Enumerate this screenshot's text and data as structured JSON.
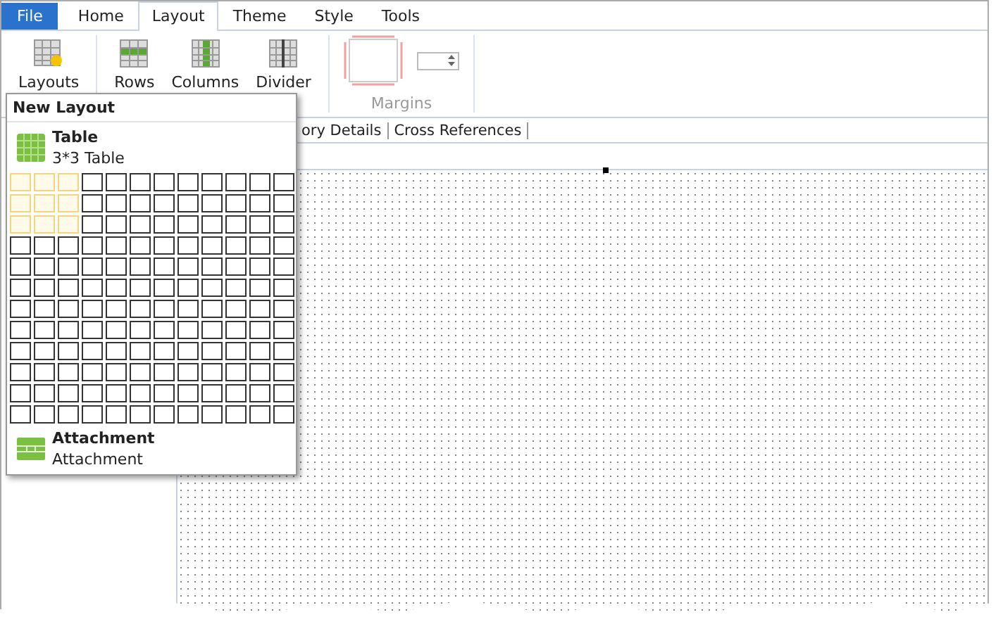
{
  "menu_tabs": [
    {
      "label": "File",
      "kind": "file",
      "selected": false
    },
    {
      "label": "Home",
      "kind": "tab",
      "selected": false
    },
    {
      "label": "Layout",
      "kind": "tab",
      "selected": true
    },
    {
      "label": "Theme",
      "kind": "tab",
      "selected": false
    },
    {
      "label": "Style",
      "kind": "tab",
      "selected": false
    },
    {
      "label": "Tools",
      "kind": "tab",
      "selected": false
    }
  ],
  "ribbon": {
    "layouts_button": "Layouts",
    "table_buttons": [
      {
        "label": "Rows",
        "kind": "rows"
      },
      {
        "label": "Columns",
        "kind": "columns"
      },
      {
        "label": "Divider",
        "kind": "divider"
      }
    ],
    "margins_group": "Margins"
  },
  "document_tabs": [
    "ory Details",
    "Cross References"
  ],
  "new_layout_menu": {
    "title": "New Layout",
    "table_item": {
      "title": "Table",
      "subtitle": "3*3 Table"
    },
    "grid_rows": [
      {
        "selected": [
          true,
          true,
          true,
          false,
          false,
          false,
          false,
          false,
          false,
          false,
          false,
          false
        ]
      },
      {
        "selected": [
          true,
          true,
          true,
          false,
          false,
          false,
          false,
          false,
          false,
          false,
          false,
          false
        ]
      },
      {
        "selected": [
          true,
          true,
          true,
          false,
          false,
          false,
          false,
          false,
          false,
          false,
          false,
          false
        ]
      },
      {
        "selected": [
          false,
          false,
          false,
          false,
          false,
          false,
          false,
          false,
          false,
          false,
          false,
          false
        ]
      },
      {
        "selected": [
          false,
          false,
          false,
          false,
          false,
          false,
          false,
          false,
          false,
          false,
          false,
          false
        ]
      },
      {
        "selected": [
          false,
          false,
          false,
          false,
          false,
          false,
          false,
          false,
          false,
          false,
          false,
          false
        ]
      },
      {
        "selected": [
          false,
          false,
          false,
          false,
          false,
          false,
          false,
          false,
          false,
          false,
          false,
          false
        ]
      },
      {
        "selected": [
          false,
          false,
          false,
          false,
          false,
          false,
          false,
          false,
          false,
          false,
          false,
          false
        ]
      },
      {
        "selected": [
          false,
          false,
          false,
          false,
          false,
          false,
          false,
          false,
          false,
          false,
          false,
          false
        ]
      },
      {
        "selected": [
          false,
          false,
          false,
          false,
          false,
          false,
          false,
          false,
          false,
          false,
          false,
          false
        ]
      },
      {
        "selected": [
          false,
          false,
          false,
          false,
          false,
          false,
          false,
          false,
          false,
          false,
          false,
          false
        ]
      },
      {
        "selected": [
          false,
          false,
          false,
          false,
          false,
          false,
          false,
          false,
          false,
          false,
          false,
          false
        ]
      }
    ],
    "attachment_item": {
      "title": "Attachment",
      "subtitle": "Attachment"
    }
  }
}
